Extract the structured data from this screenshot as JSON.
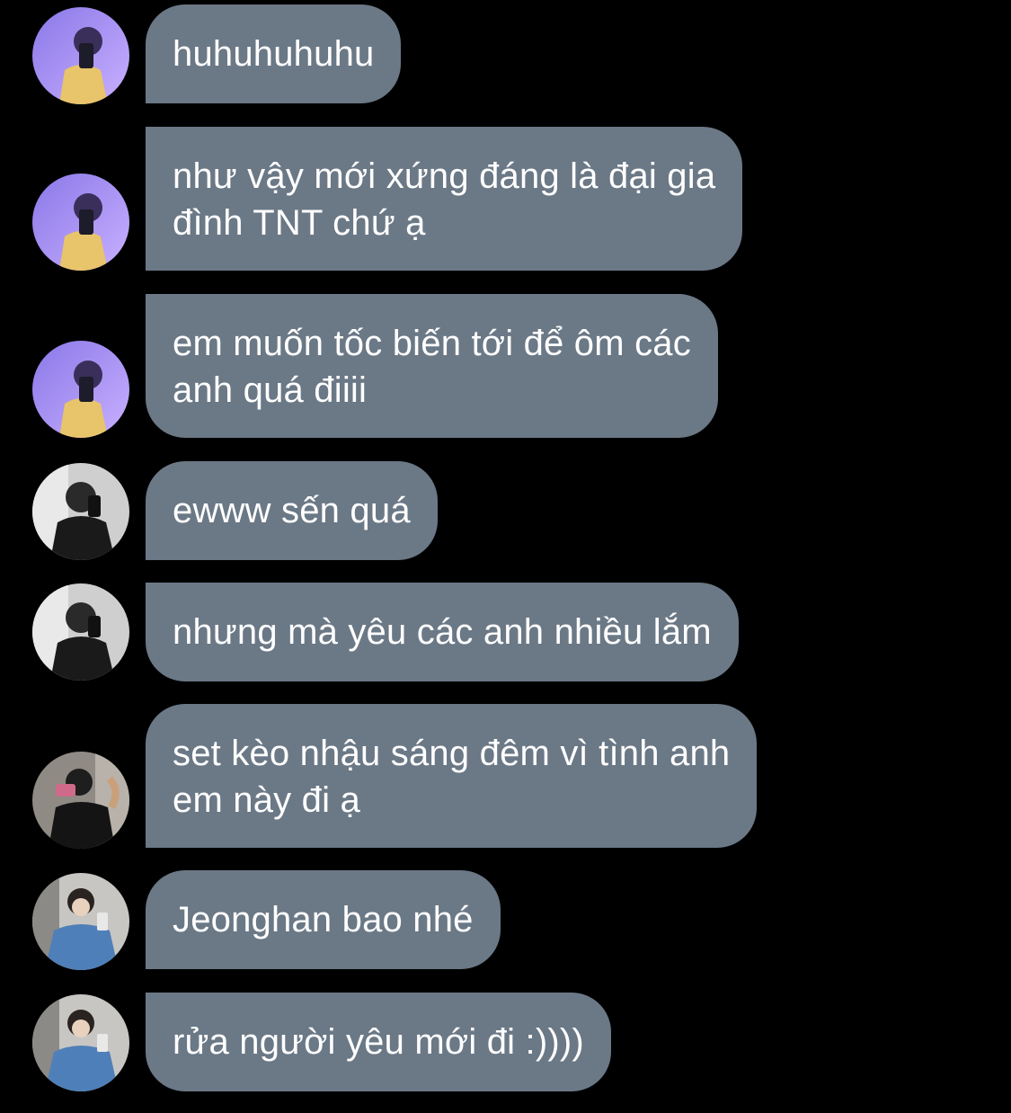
{
  "messages": [
    {
      "avatar": "avatar-user-purple",
      "text": "huhuhuhuhu"
    },
    {
      "avatar": "avatar-user-purple",
      "text": "như vậy mới xứng đáng là đại gia\nđình TNT chứ ạ"
    },
    {
      "avatar": "avatar-user-purple",
      "text": "em muốn tốc biến tới để ôm các\nanh quá điiii"
    },
    {
      "avatar": "avatar-user-bw",
      "text": "ewww sến quá"
    },
    {
      "avatar": "avatar-user-bw",
      "text": "nhưng mà yêu các anh nhiều lắm"
    },
    {
      "avatar": "avatar-user-dark",
      "text": "set kèo nhậu sáng đêm vì tình anh\nem này đi ạ"
    },
    {
      "avatar": "avatar-user-denim",
      "text": "Jeonghan bao nhé"
    },
    {
      "avatar": "avatar-user-denim",
      "text": "rửa người yêu mới đi :))))"
    }
  ],
  "colors": {
    "background": "#000000",
    "bubble": "#6b7886",
    "text": "#ffffff"
  }
}
